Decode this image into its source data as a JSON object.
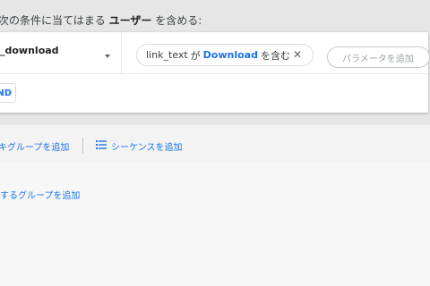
{
  "heading": {
    "prefix": "次の条件に当てはまる",
    "subject": "ユーザー",
    "suffix": "を含める:"
  },
  "condition": {
    "event_name": "_download",
    "chip": {
      "param": "link_text",
      "particle": "が",
      "value": "Download",
      "operator": "を含む",
      "close_glyph": "✕"
    },
    "add_param_label": "パラメータを追加",
    "and_label": "ND"
  },
  "actions": {
    "add_group_label": "キグループを追加",
    "add_sequence_label": "シーケンスを追加"
  },
  "lower": {
    "add_group_label": "するグループを追加"
  },
  "colors": {
    "accent": "#1a73e8",
    "band": "#e6e6e6"
  },
  "icons": {
    "sequence": "sequence-list-icon",
    "dropdown": "caret-down-icon",
    "close": "close-icon"
  }
}
